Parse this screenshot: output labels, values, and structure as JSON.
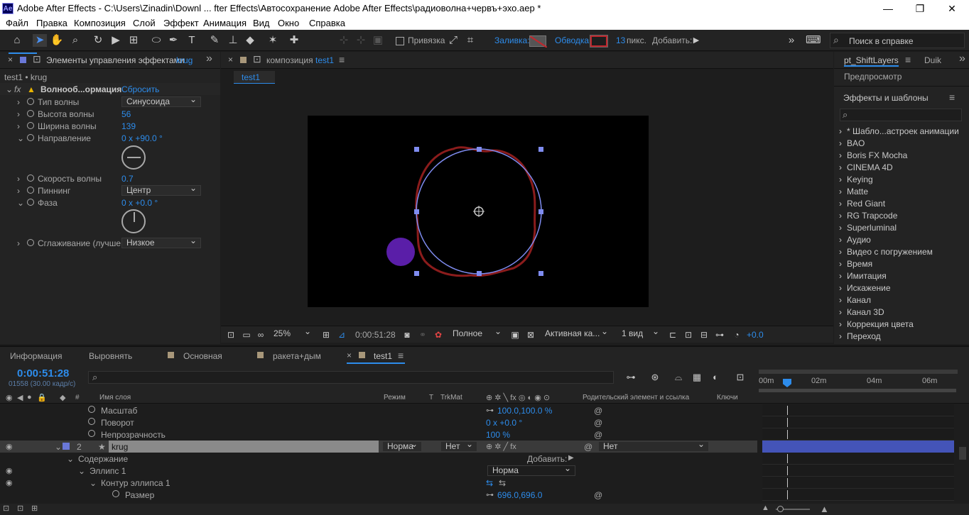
{
  "titlebar": {
    "app_icon": "Ae",
    "title": "Adobe After Effects - C:\\Users\\Zinadin\\Downl ... fter Effects\\Автосохранение Adobe After Effects\\радиоволна+червъ+эхо.aep *",
    "minimize": "—",
    "maximize": "❐",
    "close": "✕"
  },
  "menu": [
    "Файл",
    "Правка",
    "Композиция",
    "Слой",
    "Эффект",
    "Анимация",
    "Вид",
    "Окно",
    "Справка"
  ],
  "toolbar": {
    "snapping": "Привязка",
    "fill": "Заливка:",
    "stroke": "Обводка:",
    "stroke_width": "13",
    "px": "пикс.",
    "add": "Добавить:",
    "search_placeholder": "Поиск в справке",
    "fill_color": "#8b1c1c",
    "stroke_color": "#c0272d"
  },
  "effects_panel": {
    "tab": "Элементы управления эффектами",
    "tab_layer": "krug",
    "layer_path": "test1 • krug",
    "effect_name": "Волнооб...ормация",
    "reset": "Сбросить",
    "props": [
      {
        "label": "Тип волны",
        "type": "dropdown",
        "value": "Синусоида"
      },
      {
        "label": "Высота волны",
        "type": "num",
        "value": "56"
      },
      {
        "label": "Ширина волны",
        "type": "num",
        "value": "139"
      },
      {
        "label": "Направление",
        "type": "num",
        "value": "0 x +90.0 °"
      },
      {
        "label": "Скорость волны",
        "type": "num",
        "value": "0.7"
      },
      {
        "label": "Пиннинг",
        "type": "dropdown",
        "value": "Центр"
      },
      {
        "label": "Фаза",
        "type": "num",
        "value": "0 x +0.0 °"
      },
      {
        "label": "Сглаживание (лучше",
        "type": "dropdown",
        "value": "Низкое"
      }
    ]
  },
  "comp_panel": {
    "tab": "композиция",
    "comp_name": "test1",
    "sub_tab": "test1",
    "zoom": "25%",
    "timecode": "0:00:51:28",
    "quality": "Полное",
    "camera": "Активная ка...",
    "views": "1 вид",
    "exposure": "+0.0"
  },
  "right_panel": {
    "tab1": "pt_ShiftLayers",
    "tab2": "Duik",
    "preview": "Предпросмотр",
    "effects_title": "Эффекты и шаблоны",
    "categories": [
      "* Шабло...астроек анимации",
      "BAO",
      "Boris FX Mocha",
      "CINEMA 4D",
      "Keying",
      "Matte",
      "Red Giant",
      "RG Trapcode",
      "Superluminal",
      "Аудио",
      "Видео с погружением",
      "Время",
      "Имитация",
      "Искажение",
      "Канал",
      "Канал 3D",
      "Коррекция цвета",
      "Переход"
    ]
  },
  "bottom_tabs": {
    "info": "Информация",
    "align": "Выровнять",
    "main": "Основная",
    "rocket": "ракета+дым",
    "test1": "test1"
  },
  "timeline": {
    "timecode": "0:00:51:28",
    "frames": "01558 (30.00 кадр/с)",
    "columns": {
      "layer_name": "Имя слоя",
      "mode": "Режим",
      "t": "T",
      "trkmat": "TrkMat",
      "parent": "Родительский элемент и ссылка",
      "keys": "Ключи"
    },
    "ruler": [
      "00m",
      "02m",
      "04m",
      "06m"
    ],
    "rows": [
      {
        "name": "Масштаб",
        "value": "100.0,100.0 %"
      },
      {
        "name": "Поворот",
        "value": "0 x +0.0 °"
      },
      {
        "name": "Непрозрачность",
        "value": "100 %"
      },
      {
        "num": "2",
        "name": "krug",
        "mode": "Норма",
        "trkmat": "Нет",
        "parent": "Нет"
      },
      {
        "name": "Содержание",
        "add": "Добавить:"
      },
      {
        "name": "Эллипс 1",
        "mode": "Норма"
      },
      {
        "name": "Контур эллипса 1"
      },
      {
        "name": "Размер",
        "value": "696.0,696.0"
      }
    ]
  }
}
